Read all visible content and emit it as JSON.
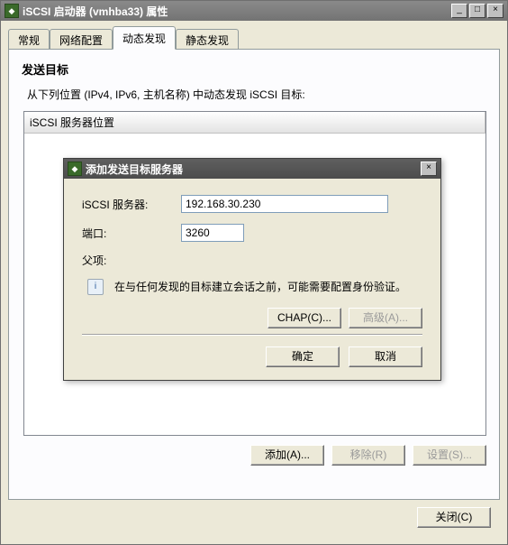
{
  "window": {
    "title": "iSCSI 启动器 (vmhba33) 属性",
    "min": "_",
    "max": "□",
    "close": "×"
  },
  "tabs": {
    "general": "常规",
    "network": "网络配置",
    "dynamic": "动态发现",
    "static": "静态发现"
  },
  "panel": {
    "heading": "发送目标",
    "instruction": "从下列位置 (IPv4, IPv6, 主机名称) 中动态发现 iSCSI 目标:",
    "column_header": "iSCSI 服务器位置"
  },
  "buttons": {
    "add": "添加(A)...",
    "remove": "移除(R)",
    "settings": "设置(S)...",
    "close": "关闭(C)"
  },
  "modal": {
    "title": "添加发送目标服务器",
    "close": "×",
    "server_label": "iSCSI 服务器:",
    "server_value": "192.168.30.230",
    "port_label": "端口:",
    "port_value": "3260",
    "parent_label": "父项:",
    "note": "在与任何发现的目标建立会话之前，可能需要配置身份验证。",
    "chap": "CHAP(C)...",
    "advanced": "高级(A)...",
    "ok": "确定",
    "cancel": "取消"
  }
}
